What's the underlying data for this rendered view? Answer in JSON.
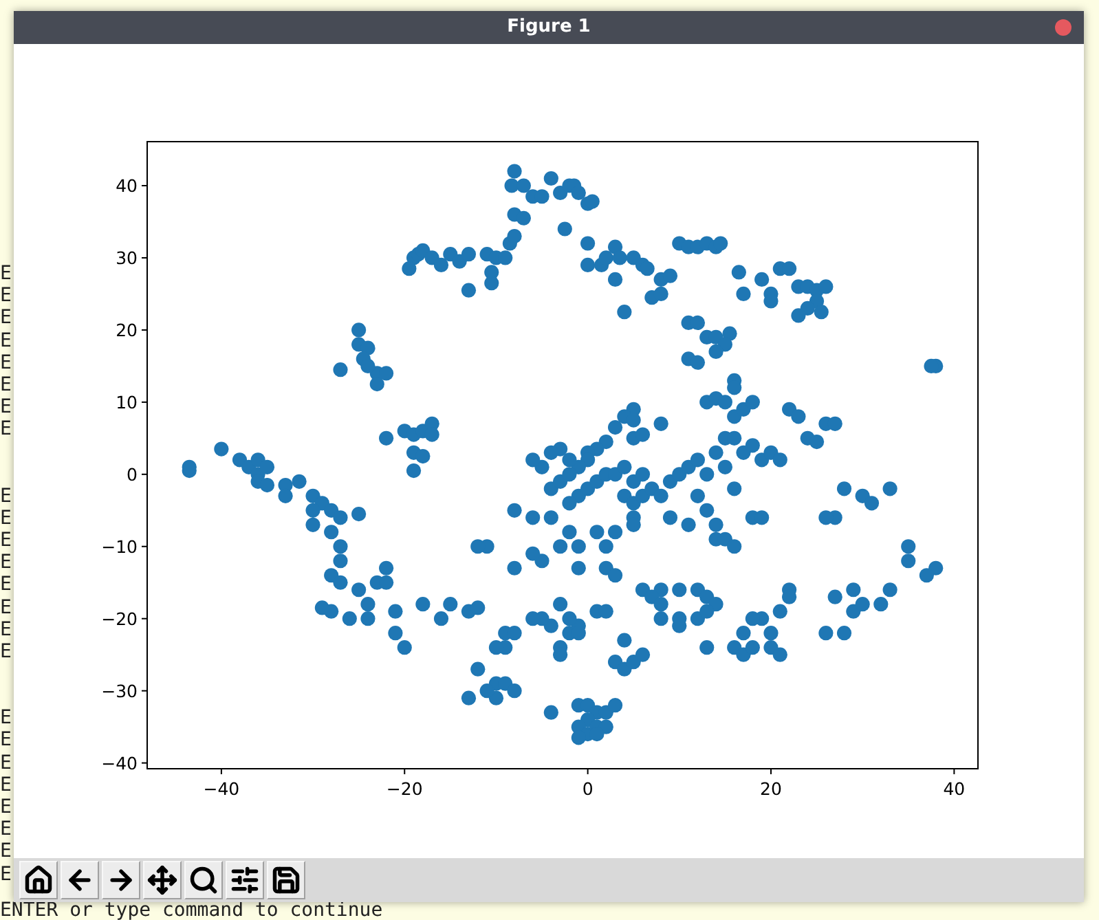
{
  "terminal": {
    "line_groups": [
      [
        "E",
        "E",
        "E",
        "E",
        "E",
        "E",
        "E",
        "E"
      ],
      [
        "E",
        "E",
        "E",
        "E",
        "E",
        "E",
        "E",
        "E"
      ],
      [
        "E",
        "E",
        "E",
        "E",
        "E",
        "E",
        "E",
        "E"
      ]
    ],
    "prompt": "ENTER or type command to continue"
  },
  "window": {
    "title": "Figure 1"
  },
  "chart_data": {
    "type": "scatter",
    "xlim": [
      -48.1,
      42.6
    ],
    "ylim": [
      -40.8,
      46.1
    ],
    "xticks": [
      {
        "value": -40,
        "label": "−40"
      },
      {
        "value": -20,
        "label": "−20"
      },
      0,
      20,
      40
    ],
    "yticks": [
      {
        "value": -40,
        "label": "−40"
      },
      {
        "value": -30,
        "label": "−30"
      },
      {
        "value": -20,
        "label": "−20"
      },
      {
        "value": -10,
        "label": "−10"
      },
      0,
      10,
      20,
      30,
      40
    ],
    "x": [
      -8,
      -8.3,
      -7,
      -6,
      -5,
      -4,
      -3,
      -2,
      -1.5,
      -1,
      0,
      0.5,
      -2.5,
      -8,
      -7,
      -8.5,
      -8,
      -19,
      -19.5,
      -18.5,
      -18,
      -17,
      -16,
      -15,
      -14,
      -13,
      -13,
      -11,
      -10,
      -10.5,
      -10.5,
      -9,
      0,
      0,
      1.5,
      2,
      3,
      3.5,
      3,
      5,
      6,
      6.5,
      8,
      9,
      7,
      8,
      4,
      10,
      11,
      12,
      13,
      14,
      14.5,
      16.5,
      17,
      19,
      20,
      20,
      21,
      22,
      23,
      24,
      25,
      26,
      25,
      24,
      23,
      25.5,
      11,
      12,
      13,
      14,
      15.5,
      15,
      11,
      14,
      12,
      -25,
      -25,
      -24,
      -24.5,
      -23,
      -22,
      -23,
      -27,
      -24,
      -22,
      -20,
      -19,
      -18,
      -17,
      -17,
      -19,
      -18,
      -19,
      -43.5,
      -43.5,
      -40,
      -38,
      -37,
      -36,
      -36,
      -35,
      -36,
      -35,
      -33,
      -33,
      -31.5,
      -30,
      -29,
      -30,
      -30,
      -28,
      -27,
      -28,
      -27,
      -27,
      -28,
      -27,
      -25,
      -25,
      -24,
      -23,
      -22,
      -22,
      -24,
      -26,
      -28,
      -29,
      -21,
      -21,
      -20,
      -18,
      -16,
      -15,
      -13,
      -12,
      5,
      4,
      5,
      3,
      5,
      6,
      8,
      2,
      1,
      0,
      0,
      -1,
      -2,
      -3,
      -4,
      -5,
      -6,
      -4,
      -3,
      -2,
      -1,
      -2,
      0,
      1,
      2,
      3,
      4,
      5,
      6,
      4,
      5,
      6,
      7,
      9,
      10,
      11,
      12,
      13,
      14,
      15,
      16,
      17,
      18,
      19,
      20,
      21,
      15,
      16,
      12,
      13,
      11,
      14,
      14,
      15,
      16,
      18,
      19,
      9,
      8,
      5,
      5,
      3,
      1,
      2,
      -1,
      -2,
      -4,
      -6,
      -8,
      -5,
      -6,
      -11,
      -12,
      -8,
      -3,
      -1,
      2,
      3,
      6,
      8,
      10,
      12,
      13,
      14,
      7,
      13,
      14,
      15,
      16,
      17,
      18,
      16,
      16,
      22,
      23,
      24,
      26,
      27,
      25,
      28,
      30,
      33,
      31,
      27,
      26,
      35,
      35,
      38,
      37,
      33,
      32,
      29,
      29,
      30,
      28,
      26,
      27,
      38,
      37.5,
      22,
      22,
      21,
      19,
      20,
      18,
      17,
      16,
      17,
      18,
      20,
      21,
      13,
      12,
      13,
      10,
      10,
      8,
      8,
      1,
      2,
      -1,
      -2,
      -3,
      -2,
      -3,
      -3,
      -1,
      -4,
      -5,
      -6,
      3,
      4,
      5,
      6,
      4,
      -9,
      -8,
      -9,
      -10,
      -12,
      -10,
      -9,
      -8,
      -10,
      -13,
      -11,
      -4,
      -1,
      0,
      1,
      2,
      3,
      0,
      -1,
      0,
      1,
      2,
      -1,
      1
    ],
    "series": [
      {
        "color": "#1f77b4",
        "values": [
          42,
          40,
          40,
          38.5,
          38.5,
          41,
          39,
          40,
          40,
          39,
          37.5,
          37.8,
          34,
          36,
          35.5,
          32,
          33,
          30,
          28.5,
          30.5,
          31,
          30,
          29,
          30.5,
          29.5,
          30.5,
          25.5,
          30.5,
          30,
          28,
          26.5,
          30,
          32,
          29,
          29,
          30,
          31.5,
          30,
          27,
          30,
          29,
          28.5,
          27,
          27.5,
          24.5,
          25,
          22.5,
          32,
          31.5,
          31.5,
          32,
          31.5,
          32,
          28,
          25,
          27,
          25,
          24,
          28.5,
          28.5,
          26,
          26,
          25.5,
          26,
          24,
          23,
          22,
          22.5,
          21,
          21,
          19,
          19,
          19.5,
          18,
          16,
          17,
          15.5,
          20,
          18,
          17.5,
          16,
          14,
          14,
          12.5,
          14.5,
          15,
          5,
          6,
          5.5,
          6,
          7,
          5.5,
          3,
          2.5,
          0.5,
          0.5,
          1,
          3.5,
          2,
          1,
          2,
          0,
          1,
          -1,
          -1.5,
          -1.5,
          -3,
          -1,
          -3,
          -4,
          -5,
          -7,
          -5,
          -6,
          -8,
          -10,
          -12,
          -14,
          -15,
          -5.5,
          -16,
          -18,
          -15,
          -13,
          -15,
          -20,
          -20,
          -19,
          -18.5,
          -19,
          -22,
          -24,
          -18,
          -20,
          -18,
          -19,
          -18.5,
          9,
          8,
          7.5,
          6.5,
          5,
          5.5,
          7,
          4.5,
          3.5,
          3,
          2,
          1,
          2,
          3.5,
          3,
          1,
          2,
          -2,
          -1,
          0,
          -3,
          -4,
          -2,
          -1,
          0,
          0,
          1,
          -1,
          0,
          -3,
          -4,
          -3,
          -2,
          -1,
          0,
          1,
          2,
          0,
          3,
          5,
          5,
          3,
          4,
          2,
          3,
          2,
          1,
          -2,
          -3,
          -5,
          -7,
          -7,
          -9,
          -9,
          -10,
          -6,
          -6,
          -6,
          -3,
          -6,
          -7,
          -8,
          -8,
          -10,
          -10,
          -8,
          -6,
          -6,
          -5,
          -12,
          -11,
          -10,
          -10,
          -13,
          -10,
          -13,
          -13,
          -14,
          -16,
          -16,
          -16,
          -16,
          -17,
          -18,
          -17,
          10,
          10.5,
          10,
          8,
          9,
          10,
          13,
          12,
          9,
          8,
          5,
          7,
          7,
          4.5,
          -2,
          -3,
          -2,
          -4,
          -6,
          -6,
          -10,
          -12,
          -13,
          -14,
          -16,
          -18,
          -16,
          -19,
          -18,
          -22,
          -22,
          -17,
          15,
          15,
          -16,
          -17,
          -19,
          -20,
          -22,
          -20,
          -22,
          -24,
          -25,
          -24,
          -24,
          -25,
          -24,
          -20,
          -19,
          -21,
          -20,
          -20,
          -18,
          -19,
          -19,
          -21,
          -20,
          -18,
          -22,
          -24,
          -25,
          -22,
          -21,
          -20,
          -20,
          -26,
          -27,
          -26,
          -25,
          -23,
          -22,
          -22,
          -24,
          -24,
          -27,
          -29,
          -29,
          -30,
          -31,
          -31,
          -30,
          -33,
          -32,
          -32,
          -33,
          -33,
          -32,
          -34,
          -35,
          -36,
          -35,
          -35,
          -36.5,
          -36
        ]
      }
    ]
  }
}
